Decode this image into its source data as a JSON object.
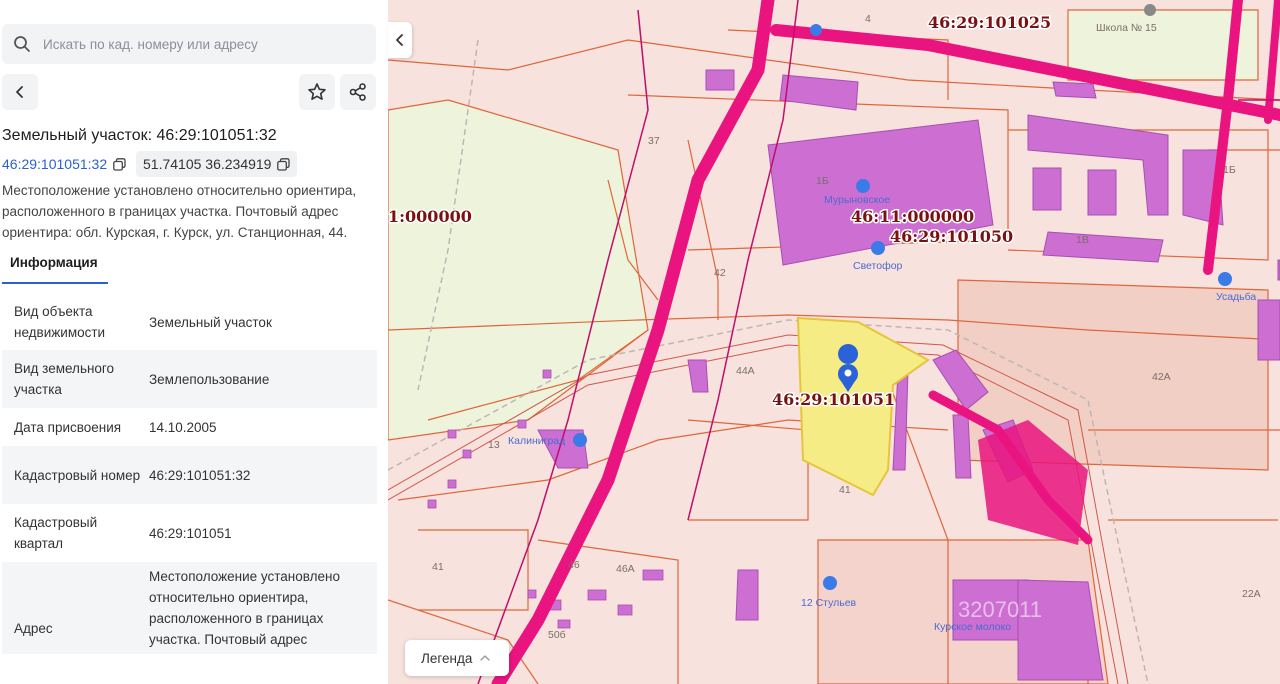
{
  "search": {
    "placeholder": "Искать по кад. номеру или адресу"
  },
  "header": {
    "title": "Земельный участок: 46:29:101051:32"
  },
  "chips": {
    "cadastral": "46:29:101051:32",
    "coords": "51.74105 36.234919"
  },
  "description": "Местоположение установлено относительно ориентира, расположенного в границах участка. Почтовый адрес ориентира: обл. Курская, г. Курск, ул. Станционная, 44.",
  "tabs": {
    "info": "Информация"
  },
  "info_rows": [
    {
      "label": "Вид объекта недвижимости",
      "value": "Земельный участок"
    },
    {
      "label": "Вид земельного участка",
      "value": "Землепользование"
    },
    {
      "label": "Дата присвоения",
      "value": "14.10.2005"
    },
    {
      "label": "Кадастровый номер",
      "value": "46:29:101051:32"
    },
    {
      "label": "Кадастровый квартал",
      "value": "46:29:101051"
    },
    {
      "label": "Адрес",
      "value": "Местоположение установлено относительно ориентира, расположенного в границах участка. Почтовый адрес"
    }
  ],
  "map": {
    "legend_label": "Легенда",
    "labels": {
      "q101025": "46:29:101025",
      "q000000_left": "1:000000",
      "q000000": "46:11:000000",
      "q101050": "46:29:101050",
      "q101051": "46:29:101051",
      "school": "Школа № 15",
      "poi_murynovskoe": "Мурыновское",
      "poi_svetofor": "Светофор",
      "poi_kaliningrad": "Калиниград",
      "poi_12chairs": "12 Стульев",
      "poi_milk": "Курское молоко",
      "poi_usadba": "Усадьба",
      "h4": "4",
      "h37": "37",
      "h1b": "1Б",
      "h1v": "1В",
      "h42": "42",
      "h44a": "44А",
      "h41": "41",
      "h42a": "42А",
      "h41b": "41",
      "h46": "46",
      "h46a": "46А",
      "h50b": "50б",
      "h22a": "22А",
      "h1b2": "1Б",
      "h13": "13"
    },
    "watermark": "3207011",
    "colors": {
      "parcel_fill": "#f6ec86",
      "building": "#cd6fd2",
      "road": "#e9147f",
      "boundary": "#e0663a"
    }
  }
}
